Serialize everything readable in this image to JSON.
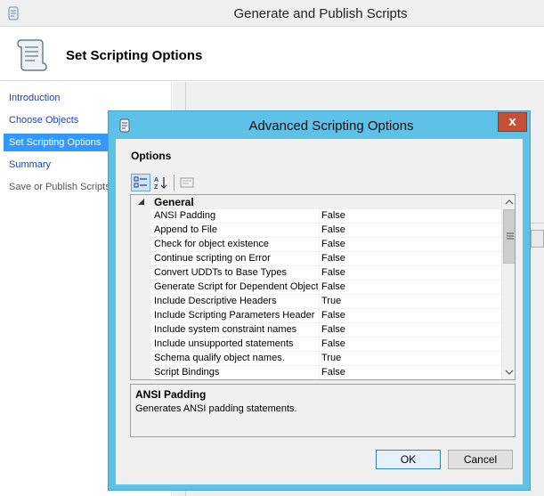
{
  "window": {
    "title": "Generate and Publish Scripts"
  },
  "header": {
    "title": "Set Scripting Options"
  },
  "nav": {
    "items": [
      {
        "label": "Introduction",
        "state": "link"
      },
      {
        "label": "Choose Objects",
        "state": "link"
      },
      {
        "label": "Set Scripting Options",
        "state": "selected"
      },
      {
        "label": "Summary",
        "state": "link"
      },
      {
        "label": "Save or Publish Scripts",
        "state": "disabled"
      }
    ]
  },
  "dialog": {
    "title": "Advanced Scripting Options",
    "close_glyph": "x",
    "options_label": "Options",
    "category": "General",
    "properties": [
      {
        "name": "ANSI Padding",
        "value": "False"
      },
      {
        "name": "Append to File",
        "value": "False"
      },
      {
        "name": "Check for object existence",
        "value": "False"
      },
      {
        "name": "Continue scripting on Error",
        "value": "False"
      },
      {
        "name": "Convert UDDTs to Base Types",
        "value": "False"
      },
      {
        "name": "Generate Script for Dependent Objects",
        "value": "False"
      },
      {
        "name": "Include Descriptive Headers",
        "value": "True"
      },
      {
        "name": "Include Scripting Parameters Header",
        "value": "False"
      },
      {
        "name": "Include system constraint names",
        "value": "False"
      },
      {
        "name": "Include unsupported statements",
        "value": "False"
      },
      {
        "name": "Schema qualify object names.",
        "value": "True"
      },
      {
        "name": "Script Bindings",
        "value": "False"
      }
    ],
    "description": {
      "title": "ANSI Padding",
      "text": "Generates ANSI padding statements."
    },
    "ok_label": "OK",
    "cancel_label": "Cancel"
  },
  "colors": {
    "dialog_frame": "#5ec1e8",
    "close_button": "#c74f38",
    "nav_selected": "#3399ff",
    "nav_link": "#1a3fbf"
  }
}
